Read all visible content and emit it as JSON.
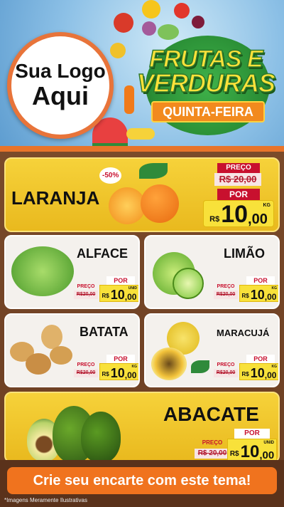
{
  "header": {
    "logo_line1": "Sua Logo",
    "logo_line2": "Aqui",
    "title_line1": "FRUTAS E",
    "title_line2": "VERDURAS",
    "day_ribbon": "QUINTA-FEIRA"
  },
  "products": [
    {
      "name": "LARANJA",
      "discount": "-50%",
      "old_label": "PREÇO",
      "old_price": "R$ 20,00",
      "por_label": "POR",
      "currency": "R$",
      "price_int": "10",
      "price_cents": ",00",
      "unit": "KG"
    },
    {
      "name": "ALFACE",
      "old_label": "PREÇO",
      "old_price": "R$20,00",
      "por_label": "POR",
      "currency": "R$",
      "price_int": "10",
      "price_cents": ",00",
      "unit": "UNID"
    },
    {
      "name": "LIMÃO",
      "old_label": "PREÇO",
      "old_price": "R$20,00",
      "por_label": "POR",
      "currency": "R$",
      "price_int": "10",
      "price_cents": ",00",
      "unit": "KG"
    },
    {
      "name": "BATATA",
      "old_label": "PREÇO",
      "old_price": "R$20,00",
      "por_label": "POR",
      "currency": "R$",
      "price_int": "10",
      "price_cents": ",00",
      "unit": "KG"
    },
    {
      "name": "MARACUJÁ",
      "old_label": "PREÇO",
      "old_price": "R$20,00",
      "por_label": "POR",
      "currency": "R$",
      "price_int": "10",
      "price_cents": ",00",
      "unit": "KG"
    },
    {
      "name": "ABACATE",
      "old_label": "PREÇO",
      "old_price": "R$ 20,00",
      "por_label": "POR",
      "currency": "R$",
      "price_int": "10",
      "price_cents": ",00",
      "unit": "UNID"
    }
  ],
  "cta": "Crie seu encarte com este tema!",
  "disclaimer": "*Imagens Meramente Ilustrativas",
  "colors": {
    "accent_orange": "#f0731e",
    "price_red": "#c8102e",
    "price_yellow": "#f8e13a",
    "card_yellow": "#f6d23a",
    "title_green": "#2f7a2a"
  }
}
